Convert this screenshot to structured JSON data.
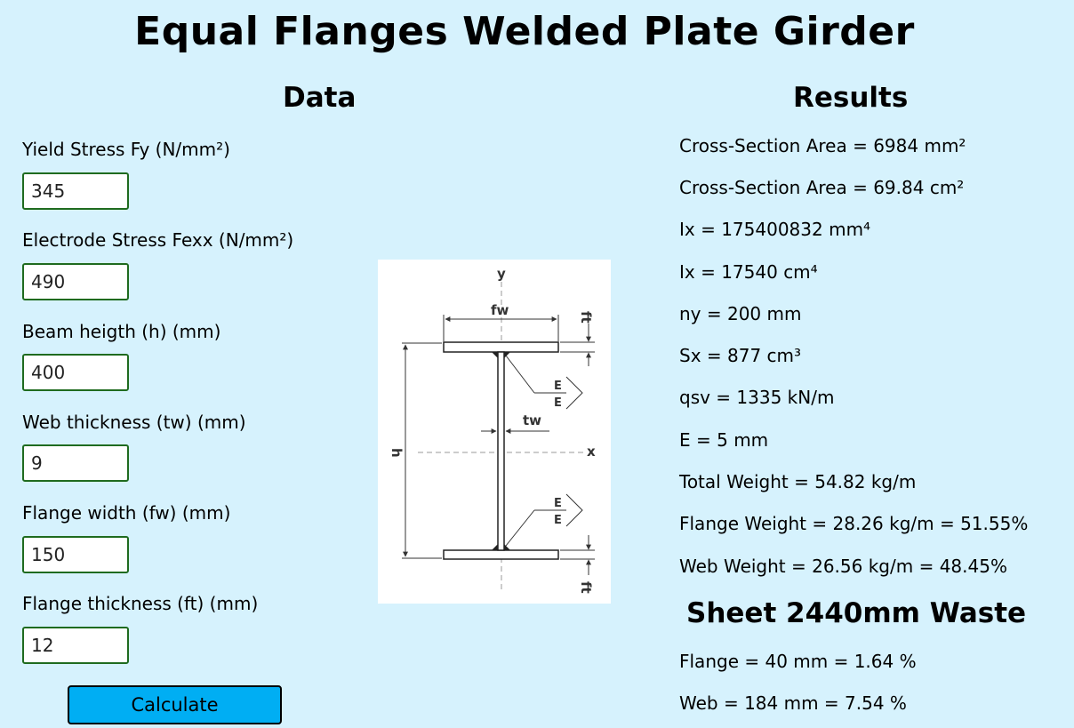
{
  "title": "Equal Flanges Welded Plate Girder",
  "data_section": {
    "heading": "Data",
    "fields": [
      {
        "label": "Yield Stress Fy (N/mm²)",
        "value": "345"
      },
      {
        "label": "Electrode Stress Fexx (N/mm²)",
        "value": "490"
      },
      {
        "label": "Beam heigth (h) (mm)",
        "value": "400"
      },
      {
        "label": "Web thickness (tw) (mm)",
        "value": "9"
      },
      {
        "label": "Flange width (fw) (mm)",
        "value": "150"
      },
      {
        "label": "Flange thickness (ft) (mm)",
        "value": "12"
      }
    ],
    "calculate_label": "Calculate"
  },
  "diagram": {
    "labels": {
      "y": "y",
      "x": "x",
      "fw": "fw",
      "ft": "ft",
      "tw": "tw",
      "h": "h",
      "e": "E"
    }
  },
  "results_section": {
    "heading": "Results",
    "lines": [
      "Cross-Section Area = 6984 mm²",
      "Cross-Section Area = 69.84 cm²",
      "Ix = 175400832 mm⁴",
      "Ix = 17540 cm⁴",
      "ny = 200 mm",
      "Sx = 877 cm³",
      "qsv = 1335 kN/m",
      "E = 5 mm",
      "Total Weight = 54.82 kg/m",
      "Flange Weight = 28.26 kg/m = 51.55%",
      "Web Weight = 26.56 kg/m = 48.45%"
    ]
  },
  "waste_section": {
    "heading": "Sheet 2440mm Waste",
    "lines": [
      "Flange = 40 mm = 1.64 %",
      "Web = 184 mm = 7.54 %"
    ]
  },
  "colors": {
    "background": "#d6f2fd",
    "input_border": "#1f6b1f",
    "button": "#00aef3"
  }
}
